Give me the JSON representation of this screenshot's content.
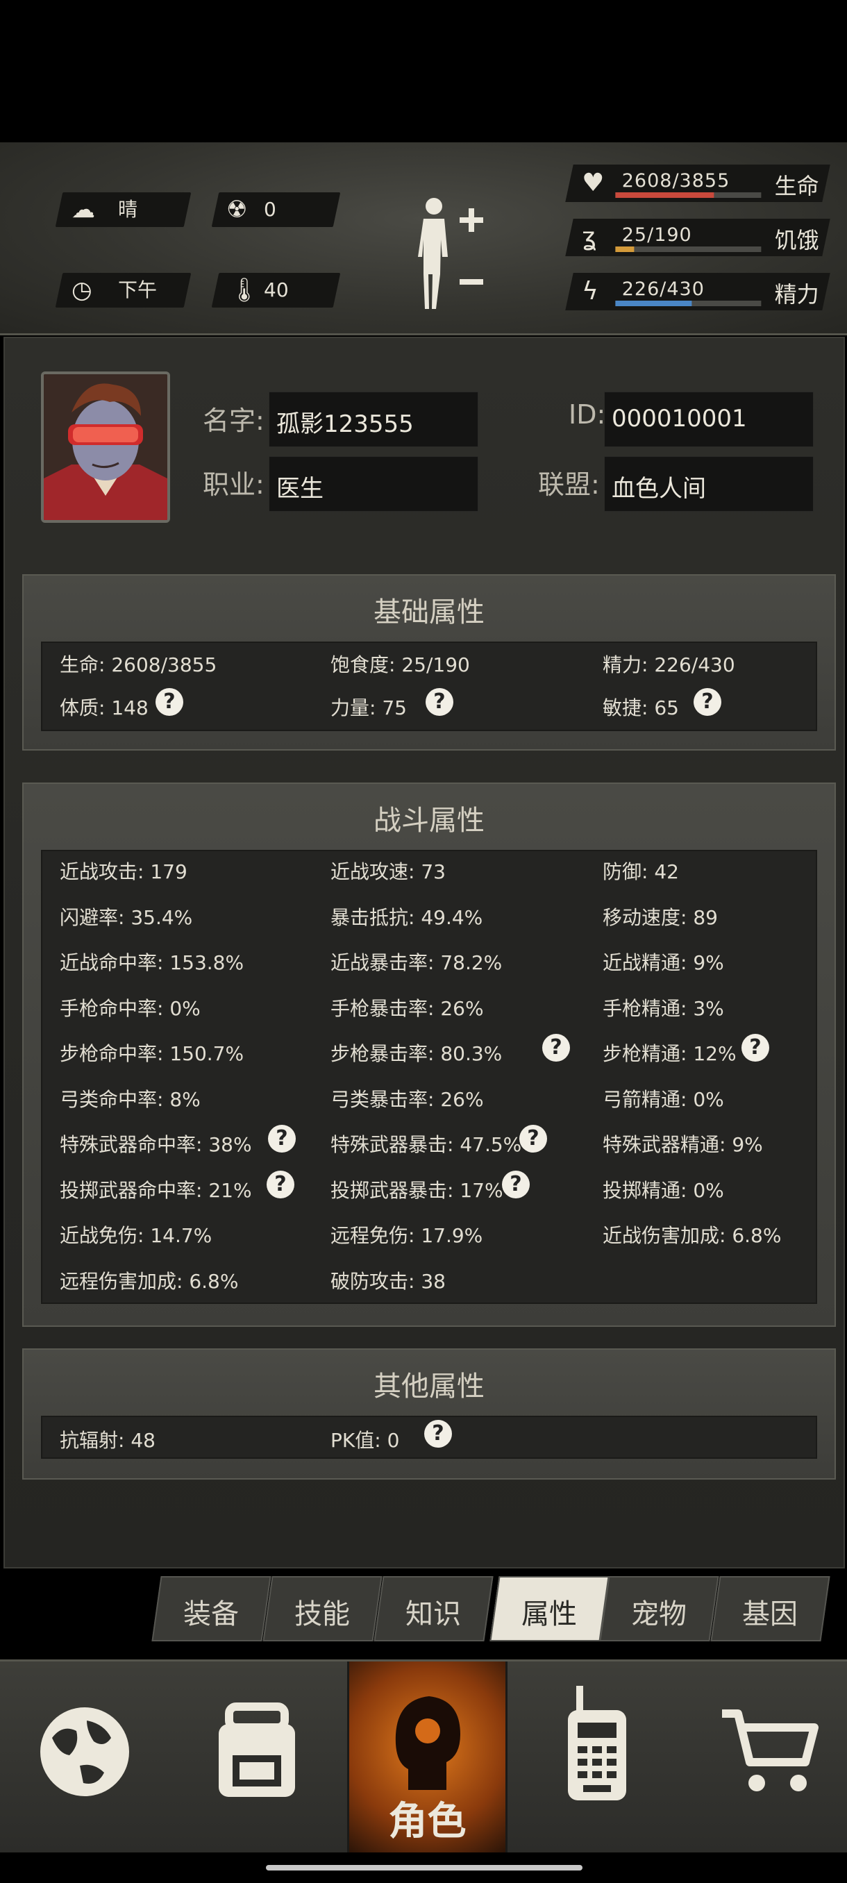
{
  "hud": {
    "weather": "晴",
    "radiation": "0",
    "time_of_day": "下午",
    "temperature": "40",
    "life": {
      "text": "2608/3855",
      "label": "生命",
      "fraction": 0.676,
      "color": "#c94a3c"
    },
    "hunger": {
      "text": "25/190",
      "label": "饥饿",
      "fraction": 0.13,
      "color": "#d39a3a"
    },
    "energy": {
      "text": "226/430",
      "label": "精力",
      "fraction": 0.526,
      "color": "#4a86c6"
    },
    "icons": [
      "weather-sun-cloud-icon",
      "radiation-icon",
      "clock-icon",
      "thermometer-icon",
      "body-figure-icon",
      "heart-icon",
      "stomach-icon",
      "brain-icon"
    ]
  },
  "profile": {
    "name_label": "名字:",
    "name_value": "孤影123555",
    "id_label": "ID:",
    "id_value": "000010001",
    "job_label": "职业:",
    "job_value": "医生",
    "alliance_label": "联盟:",
    "alliance_value": "血色人间"
  },
  "basic": {
    "title": "基础属性",
    "items": [
      "生命: 2608/3855",
      "饱食度: 25/190",
      "精力: 226/430",
      "体质: 148",
      "力量: 75",
      "敏捷: 65"
    ]
  },
  "combat": {
    "title": "战斗属性",
    "items": [
      "近战攻击: 179",
      "近战攻速: 73",
      "防御: 42",
      "闪避率: 35.4%",
      "暴击抵抗: 49.4%",
      "移动速度: 89",
      "近战命中率: 153.8%",
      "近战暴击率: 78.2%",
      "近战精通: 9%",
      "手枪命中率: 0%",
      "手枪暴击率: 26%",
      "手枪精通: 3%",
      "步枪命中率: 150.7%",
      "步枪暴击率: 80.3%",
      "步枪精通: 12%",
      "弓类命中率: 8%",
      "弓类暴击率: 26%",
      "弓箭精通: 0%",
      "特殊武器命中率: 38%",
      "特殊武器暴击: 47.5%",
      "特殊武器精通: 9%",
      "投掷武器命中率: 21%",
      "投掷武器暴击: 17%",
      "投掷精通: 0%",
      "近战免伤: 14.7%",
      "远程免伤: 17.9%",
      "近战伤害加成: 6.8%",
      "远程伤害加成: 6.8%",
      "破防攻击: 38"
    ]
  },
  "other": {
    "title": "其他属性",
    "items": [
      "抗辐射: 48",
      "PK值: 0"
    ]
  },
  "help_mark": "?",
  "tabs": [
    "装备",
    "技能",
    "知识",
    "属性",
    "宠物",
    "基因"
  ],
  "active_tab": "属性",
  "nav": {
    "character_label": "角色",
    "items": [
      "globe-icon",
      "backpack-icon",
      "character-icon",
      "walkie-talkie-icon",
      "shopping-cart-icon"
    ]
  }
}
